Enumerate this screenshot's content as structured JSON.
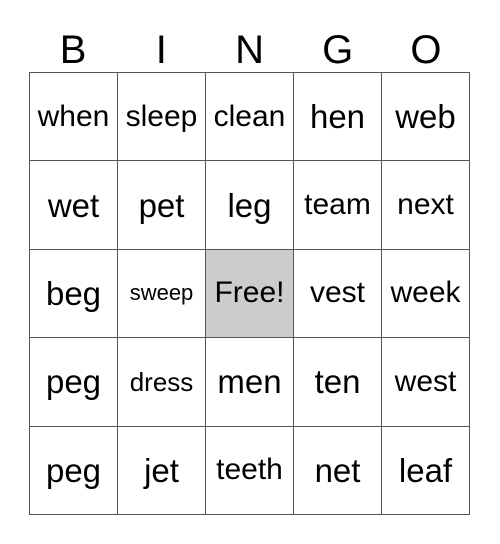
{
  "card": {
    "header": {
      "letters": [
        "B",
        "I",
        "N",
        "G",
        "O"
      ]
    },
    "free_space": {
      "label": "Free!",
      "background_color": "#cccccc",
      "row": 3,
      "column": 3
    },
    "colors": {
      "text": "#000000",
      "background": "#ffffff",
      "grid_line": "#555555",
      "free_cell_fill": "#cccccc"
    },
    "columns": [
      {
        "letter": "B",
        "cells": [
          {
            "text": "when",
            "size": "md",
            "free": false
          },
          {
            "text": "wet",
            "size": "lg",
            "free": false
          },
          {
            "text": "beg",
            "size": "lg",
            "free": false
          },
          {
            "text": "peg",
            "size": "lg",
            "free": false
          },
          {
            "text": "peg",
            "size": "lg",
            "free": false
          }
        ]
      },
      {
        "letter": "I",
        "cells": [
          {
            "text": "sleep",
            "size": "md",
            "free": false
          },
          {
            "text": "pet",
            "size": "lg",
            "free": false
          },
          {
            "text": "sweep",
            "size": "xs",
            "free": false
          },
          {
            "text": "dress",
            "size": "sm",
            "free": false
          },
          {
            "text": "jet",
            "size": "lg",
            "free": false
          }
        ]
      },
      {
        "letter": "N",
        "cells": [
          {
            "text": "clean",
            "size": "md",
            "free": false
          },
          {
            "text": "leg",
            "size": "lg",
            "free": false
          },
          {
            "text": "Free!",
            "size": "md",
            "free": true
          },
          {
            "text": "men",
            "size": "lg",
            "free": false
          },
          {
            "text": "teeth",
            "size": "md",
            "free": false
          }
        ]
      },
      {
        "letter": "G",
        "cells": [
          {
            "text": "hen",
            "size": "lg",
            "free": false
          },
          {
            "text": "team",
            "size": "md",
            "free": false
          },
          {
            "text": "vest",
            "size": "md",
            "free": false
          },
          {
            "text": "ten",
            "size": "lg",
            "free": false
          },
          {
            "text": "net",
            "size": "lg",
            "free": false
          }
        ]
      },
      {
        "letter": "O",
        "cells": [
          {
            "text": "web",
            "size": "lg",
            "free": false
          },
          {
            "text": "next",
            "size": "md",
            "free": false
          },
          {
            "text": "week",
            "size": "md",
            "free": false
          },
          {
            "text": "west",
            "size": "md",
            "free": false
          },
          {
            "text": "leaf",
            "size": "lg",
            "free": false
          }
        ]
      }
    ]
  }
}
